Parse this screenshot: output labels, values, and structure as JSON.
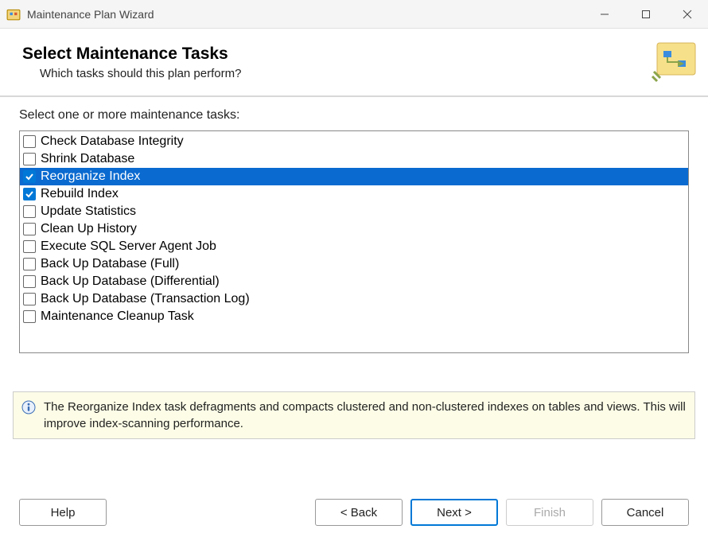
{
  "window": {
    "title": "Maintenance Plan Wizard"
  },
  "header": {
    "title": "Select Maintenance Tasks",
    "subtitle": "Which tasks should this plan perform?"
  },
  "content": {
    "list_label": "Select one or more maintenance tasks:"
  },
  "tasks": [
    {
      "label": "Check Database Integrity",
      "checked": false,
      "selected": false
    },
    {
      "label": "Shrink Database",
      "checked": false,
      "selected": false
    },
    {
      "label": "Reorganize Index",
      "checked": true,
      "selected": true
    },
    {
      "label": "Rebuild Index",
      "checked": true,
      "selected": false
    },
    {
      "label": "Update Statistics",
      "checked": false,
      "selected": false
    },
    {
      "label": "Clean Up History",
      "checked": false,
      "selected": false
    },
    {
      "label": "Execute SQL Server Agent Job",
      "checked": false,
      "selected": false
    },
    {
      "label": "Back Up Database (Full)",
      "checked": false,
      "selected": false
    },
    {
      "label": "Back Up Database (Differential)",
      "checked": false,
      "selected": false
    },
    {
      "label": "Back Up Database (Transaction Log)",
      "checked": false,
      "selected": false
    },
    {
      "label": "Maintenance Cleanup Task",
      "checked": false,
      "selected": false
    }
  ],
  "info": {
    "text": "The Reorganize Index task defragments and compacts clustered and non-clustered indexes on tables and views. This will improve index-scanning performance."
  },
  "buttons": {
    "help": "Help",
    "back": "< Back",
    "next": "Next >",
    "finish": "Finish",
    "cancel": "Cancel"
  }
}
